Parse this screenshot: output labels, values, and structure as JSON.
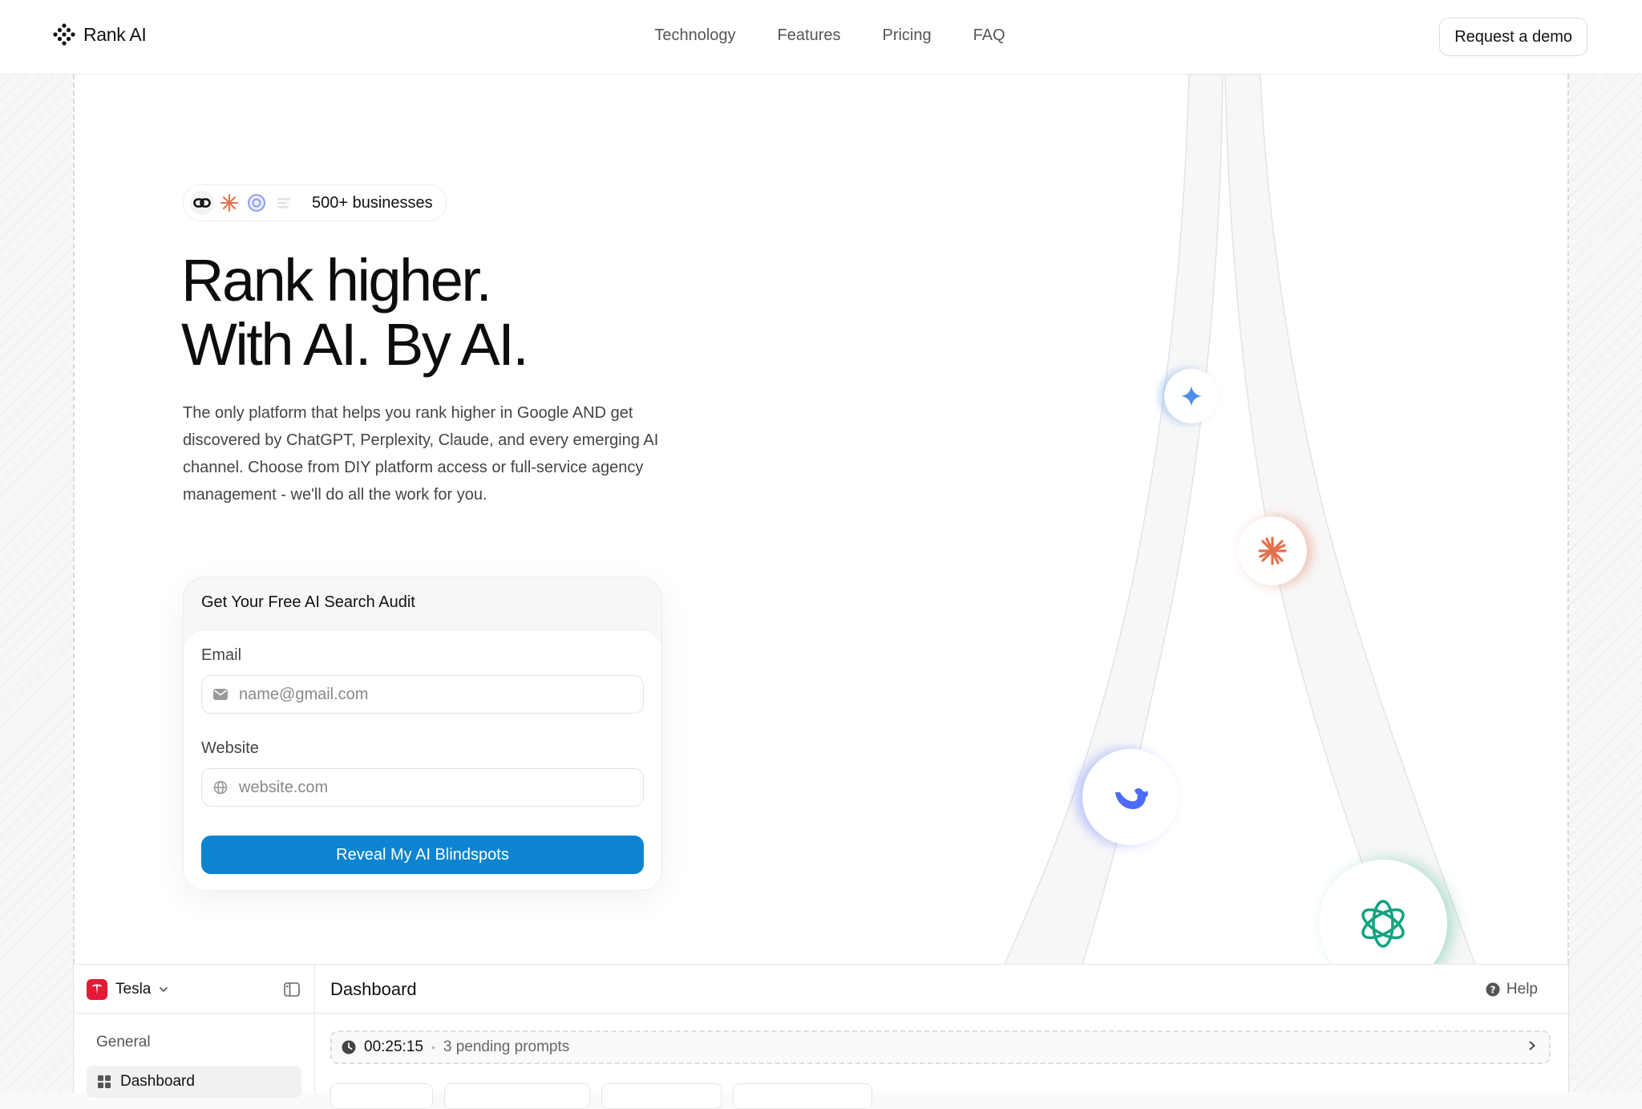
{
  "header": {
    "brand": "Rank AI",
    "nav": [
      "Technology",
      "Features",
      "Pricing",
      "FAQ"
    ],
    "demo_label": "Request a demo"
  },
  "hero": {
    "badge_logos": [
      "link-logo",
      "claude-logo",
      "perplexity-logo",
      "blurred-logo"
    ],
    "badge_text": "500+ businesses",
    "headline_line1": "Rank higher.",
    "headline_line2": "With AI. By AI.",
    "lead": "The only platform that helps you rank higher in Google AND get discovered by ChatGPT, Perplexity, Claude, and every emerging AI channel. Choose from DIY platform access or full-service agency management - we'll do all the work for you."
  },
  "audit_form": {
    "title": "Get Your Free AI Search Audit",
    "email_label": "Email",
    "email_placeholder": "name@gmail.com",
    "website_label": "Website",
    "website_placeholder": "website.com",
    "submit_label": "Reveal My AI Blindspots"
  },
  "ai_logos": [
    "gemini-icon",
    "claude-icon",
    "deepseek-icon",
    "openai-icon"
  ],
  "colors": {
    "cta": "#0d84cf",
    "claude": "#e46f4d",
    "gemini": "#4d8fe6",
    "deepseek": "#4d6bfe",
    "openai": "#10a37f",
    "tesla": "#e31937"
  },
  "dashboard": {
    "org_name": "Tesla",
    "section": "General",
    "nav_item": "Dashboard",
    "title": "Dashboard",
    "help_label": "Help",
    "timer": "00:25:15",
    "pending": "3 pending prompts"
  }
}
